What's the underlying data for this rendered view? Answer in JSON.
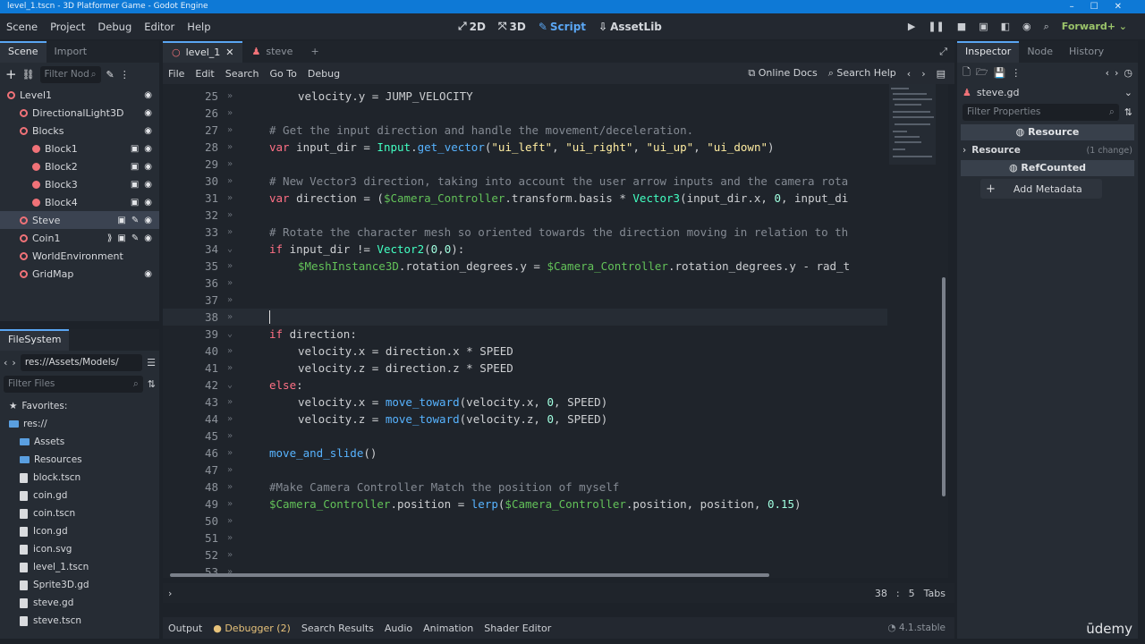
{
  "window": {
    "title": "level_1.tscn - 3D Platformer Game - Godot Engine"
  },
  "menu": [
    "Scene",
    "Project",
    "Debug",
    "Editor",
    "Help"
  ],
  "workspaces": [
    {
      "label": "2D",
      "active": false
    },
    {
      "label": "3D",
      "active": false
    },
    {
      "label": "Script",
      "active": true
    },
    {
      "label": "AssetLib",
      "active": false
    }
  ],
  "renderer": "Forward+",
  "scene_dock": {
    "tabs": [
      "Scene",
      "Import"
    ],
    "filter_placeholder": "Filter Nod",
    "tree": [
      {
        "label": "Level1",
        "depth": 0,
        "icon": "node3d-icon",
        "eye": true
      },
      {
        "label": "DirectionalLight3D",
        "depth": 1,
        "icon": "light-icon",
        "eye": true
      },
      {
        "label": "Blocks",
        "depth": 1,
        "icon": "node3d-icon",
        "eye": true
      },
      {
        "label": "Block1",
        "depth": 2,
        "icon": "block-icon",
        "eye": true,
        "extra": [
          "film-icon"
        ]
      },
      {
        "label": "Block2",
        "depth": 2,
        "icon": "block-icon",
        "eye": true,
        "extra": [
          "film-icon"
        ]
      },
      {
        "label": "Block3",
        "depth": 2,
        "icon": "block-icon",
        "eye": true,
        "extra": [
          "film-icon"
        ]
      },
      {
        "label": "Block4",
        "depth": 2,
        "icon": "block-icon",
        "eye": true,
        "extra": [
          "film-icon"
        ]
      },
      {
        "label": "Steve",
        "depth": 1,
        "icon": "character-icon",
        "eye": true,
        "selected": true,
        "extra": [
          "film-icon",
          "script-icon"
        ]
      },
      {
        "label": "Coin1",
        "depth": 1,
        "icon": "area-icon",
        "eye": true,
        "extra": [
          "signal-icon",
          "film-icon",
          "script-icon"
        ]
      },
      {
        "label": "WorldEnvironment",
        "depth": 1,
        "icon": "environment-icon",
        "eye": false
      },
      {
        "label": "GridMap",
        "depth": 1,
        "icon": "gridmap-icon",
        "eye": true
      }
    ]
  },
  "filesystem": {
    "tab": "FileSystem",
    "path": "res://Assets/Models/",
    "filter_placeholder": "Filter Files",
    "items": [
      {
        "label": "Favorites:",
        "type": "favorites",
        "depth": 0
      },
      {
        "label": "res://",
        "type": "folder",
        "depth": 0
      },
      {
        "label": "Assets",
        "type": "folder",
        "depth": 1
      },
      {
        "label": "Resources",
        "type": "folder",
        "depth": 1
      },
      {
        "label": "block.tscn",
        "type": "file",
        "depth": 1
      },
      {
        "label": "coin.gd",
        "type": "file",
        "depth": 1
      },
      {
        "label": "coin.tscn",
        "type": "file",
        "depth": 1
      },
      {
        "label": "Icon.gd",
        "type": "file",
        "depth": 1
      },
      {
        "label": "icon.svg",
        "type": "file",
        "depth": 1
      },
      {
        "label": "level_1.tscn",
        "type": "file",
        "depth": 1
      },
      {
        "label": "Sprite3D.gd",
        "type": "file",
        "depth": 1
      },
      {
        "label": "steve.gd",
        "type": "file",
        "depth": 1
      },
      {
        "label": "steve.tscn",
        "type": "file",
        "depth": 1
      }
    ]
  },
  "editor_tabs": [
    {
      "label": "level_1",
      "active": true
    },
    {
      "label": "steve",
      "active": false
    }
  ],
  "script_menu": [
    "File",
    "Edit",
    "Search",
    "Go To",
    "Debug"
  ],
  "script_links": {
    "docs": "Online Docs",
    "help": "Search Help"
  },
  "code": {
    "current_line": 38,
    "lines": [
      {
        "n": 25,
        "indent": 2,
        "fold": false,
        "tokens": [
          [
            "cn",
            "velocity.y = JUMP_VELOCITY"
          ]
        ]
      },
      {
        "n": 26,
        "indent": 0,
        "fold": false,
        "tokens": []
      },
      {
        "n": 27,
        "indent": 1,
        "fold": false,
        "tokens": [
          [
            "cm",
            "# Get the input direction and handle the movement/deceleration."
          ]
        ]
      },
      {
        "n": 28,
        "indent": 1,
        "fold": false,
        "tokens": [
          [
            "kw",
            "var"
          ],
          [
            "cn",
            " input_dir = "
          ],
          [
            "ty",
            "Input"
          ],
          [
            "cn",
            "."
          ],
          [
            "fn",
            "get_vector"
          ],
          [
            "cn",
            "("
          ],
          [
            "str",
            "\"ui_left\""
          ],
          [
            "cn",
            ", "
          ],
          [
            "str",
            "\"ui_right\""
          ],
          [
            "cn",
            ", "
          ],
          [
            "str",
            "\"ui_up\""
          ],
          [
            "cn",
            ", "
          ],
          [
            "str",
            "\"ui_down\""
          ],
          [
            "cn",
            ")"
          ]
        ]
      },
      {
        "n": 29,
        "indent": 0,
        "fold": false,
        "tokens": []
      },
      {
        "n": 30,
        "indent": 1,
        "fold": false,
        "tokens": [
          [
            "cm",
            "# New Vector3 direction, taking into account the user arrow inputs and the camera rota"
          ]
        ]
      },
      {
        "n": 31,
        "indent": 1,
        "fold": false,
        "tokens": [
          [
            "kw",
            "var"
          ],
          [
            "cn",
            " direction = ("
          ],
          [
            "nd",
            "$Camera_Controller"
          ],
          [
            "cn",
            ".transform.basis * "
          ],
          [
            "ty",
            "Vector3"
          ],
          [
            "cn",
            "(input_dir.x, "
          ],
          [
            "num",
            "0"
          ],
          [
            "cn",
            ", input_di"
          ]
        ]
      },
      {
        "n": 32,
        "indent": 0,
        "fold": false,
        "tokens": []
      },
      {
        "n": 33,
        "indent": 1,
        "fold": false,
        "tokens": [
          [
            "cm",
            "# Rotate the character mesh so oriented towards the direction moving in relation to th"
          ]
        ]
      },
      {
        "n": 34,
        "indent": 1,
        "fold": true,
        "tokens": [
          [
            "kw",
            "if"
          ],
          [
            "cn",
            " input_dir != "
          ],
          [
            "ty",
            "Vector2"
          ],
          [
            "cn",
            "("
          ],
          [
            "num",
            "0"
          ],
          [
            "cn",
            ","
          ],
          [
            "num",
            "0"
          ],
          [
            "cn",
            "):"
          ]
        ]
      },
      {
        "n": 35,
        "indent": 2,
        "fold": false,
        "tokens": [
          [
            "nd",
            "$MeshInstance3D"
          ],
          [
            "cn",
            ".rotation_degrees.y = "
          ],
          [
            "nd",
            "$Camera_Controller"
          ],
          [
            "cn",
            ".rotation_degrees.y - rad_t"
          ]
        ]
      },
      {
        "n": 36,
        "indent": 0,
        "fold": false,
        "tokens": []
      },
      {
        "n": 37,
        "indent": 0,
        "fold": false,
        "tokens": []
      },
      {
        "n": 38,
        "indent": 1,
        "fold": false,
        "tokens": []
      },
      {
        "n": 39,
        "indent": 1,
        "fold": true,
        "tokens": [
          [
            "kw",
            "if"
          ],
          [
            "cn",
            " direction:"
          ]
        ]
      },
      {
        "n": 40,
        "indent": 2,
        "fold": false,
        "tokens": [
          [
            "cn",
            "velocity.x = direction.x * SPEED"
          ]
        ]
      },
      {
        "n": 41,
        "indent": 2,
        "fold": false,
        "tokens": [
          [
            "cn",
            "velocity.z = direction.z * SPEED"
          ]
        ]
      },
      {
        "n": 42,
        "indent": 1,
        "fold": true,
        "tokens": [
          [
            "kw",
            "else"
          ],
          [
            "cn",
            ":"
          ]
        ]
      },
      {
        "n": 43,
        "indent": 2,
        "fold": false,
        "tokens": [
          [
            "cn",
            "velocity.x = "
          ],
          [
            "fn",
            "move_toward"
          ],
          [
            "cn",
            "(velocity.x, "
          ],
          [
            "num",
            "0"
          ],
          [
            "cn",
            ", SPEED)"
          ]
        ]
      },
      {
        "n": 44,
        "indent": 2,
        "fold": false,
        "tokens": [
          [
            "cn",
            "velocity.z = "
          ],
          [
            "fn",
            "move_toward"
          ],
          [
            "cn",
            "(velocity.z, "
          ],
          [
            "num",
            "0"
          ],
          [
            "cn",
            ", SPEED)"
          ]
        ]
      },
      {
        "n": 45,
        "indent": 0,
        "fold": false,
        "tokens": []
      },
      {
        "n": 46,
        "indent": 1,
        "fold": false,
        "tokens": [
          [
            "fn",
            "move_and_slide"
          ],
          [
            "cn",
            "()"
          ]
        ]
      },
      {
        "n": 47,
        "indent": 0,
        "fold": false,
        "tokens": []
      },
      {
        "n": 48,
        "indent": 1,
        "fold": false,
        "tokens": [
          [
            "cm",
            "#Make Camera Controller Match the position of myself"
          ]
        ]
      },
      {
        "n": 49,
        "indent": 1,
        "fold": false,
        "tokens": [
          [
            "nd",
            "$Camera_Controller"
          ],
          [
            "cn",
            ".position = "
          ],
          [
            "fn",
            "lerp"
          ],
          [
            "cn",
            "("
          ],
          [
            "nd",
            "$Camera_Controller"
          ],
          [
            "cn",
            ".position, position, "
          ],
          [
            "num",
            "0.15"
          ],
          [
            "cn",
            ")"
          ]
        ]
      },
      {
        "n": 50,
        "indent": 0,
        "fold": false,
        "tokens": []
      },
      {
        "n": 51,
        "indent": 0,
        "fold": false,
        "tokens": []
      },
      {
        "n": 52,
        "indent": 0,
        "fold": false,
        "tokens": []
      },
      {
        "n": 53,
        "indent": 0,
        "fold": false,
        "tokens": []
      }
    ]
  },
  "status": {
    "line": "38",
    "col": "5",
    "indent": "Tabs"
  },
  "bottom_tabs": [
    {
      "label": "Output",
      "warn": false
    },
    {
      "label": "Debugger (2)",
      "warn": true
    },
    {
      "label": "Search Results",
      "warn": false
    },
    {
      "label": "Audio",
      "warn": false
    },
    {
      "label": "Animation",
      "warn": false
    },
    {
      "label": "Shader Editor",
      "warn": false
    }
  ],
  "version": "4.1.stable",
  "inspector": {
    "tabs": [
      "Inspector",
      "Node",
      "History"
    ],
    "resource_name": "steve.gd",
    "filter_placeholder": "Filter Properties",
    "section_resource": "Resource",
    "prop_resource": "Resource",
    "prop_changes": "(1 change)",
    "section_refcounted": "RefCounted",
    "add_metadata": "Add Metadata"
  },
  "watermark": "ūdemy"
}
